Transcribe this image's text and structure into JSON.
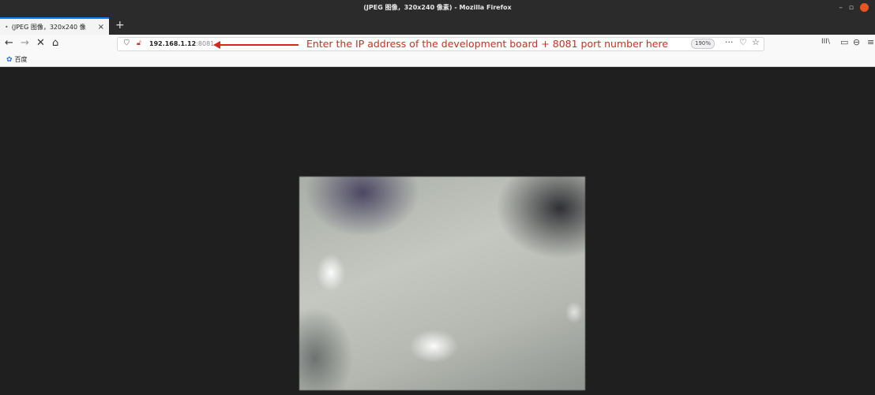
{
  "window": {
    "title": "(JPEG 图像，320x240 像素) - Mozilla Firefox",
    "controls": {
      "minimize": "–",
      "maximize": "▫"
    }
  },
  "tabs": [
    {
      "label": "(JPEG 图像，320x240 像",
      "close": "×"
    }
  ],
  "new_tab": "+",
  "nav": {
    "back": "←",
    "forward": "→",
    "stop": "✕",
    "home": "⌂"
  },
  "url": {
    "host": "192.168.1.12",
    "port": ":8081",
    "zoom": "190%"
  },
  "annotation": {
    "text": "Enter the IP address of the development board + 8081 port number here",
    "color": "#d7281d"
  },
  "toolbar_icons": {
    "more": "···",
    "pocket": "♡",
    "bookmark": "☆",
    "library": "III\\",
    "sidebar": "▭",
    "account": "⊖",
    "menu": "≡"
  },
  "bookmarks": [
    {
      "label": "百度"
    }
  ],
  "image": {
    "width": 320,
    "height": 240
  },
  "colors": {
    "accent": "#0a84ff",
    "background": "#1f1f1f"
  }
}
